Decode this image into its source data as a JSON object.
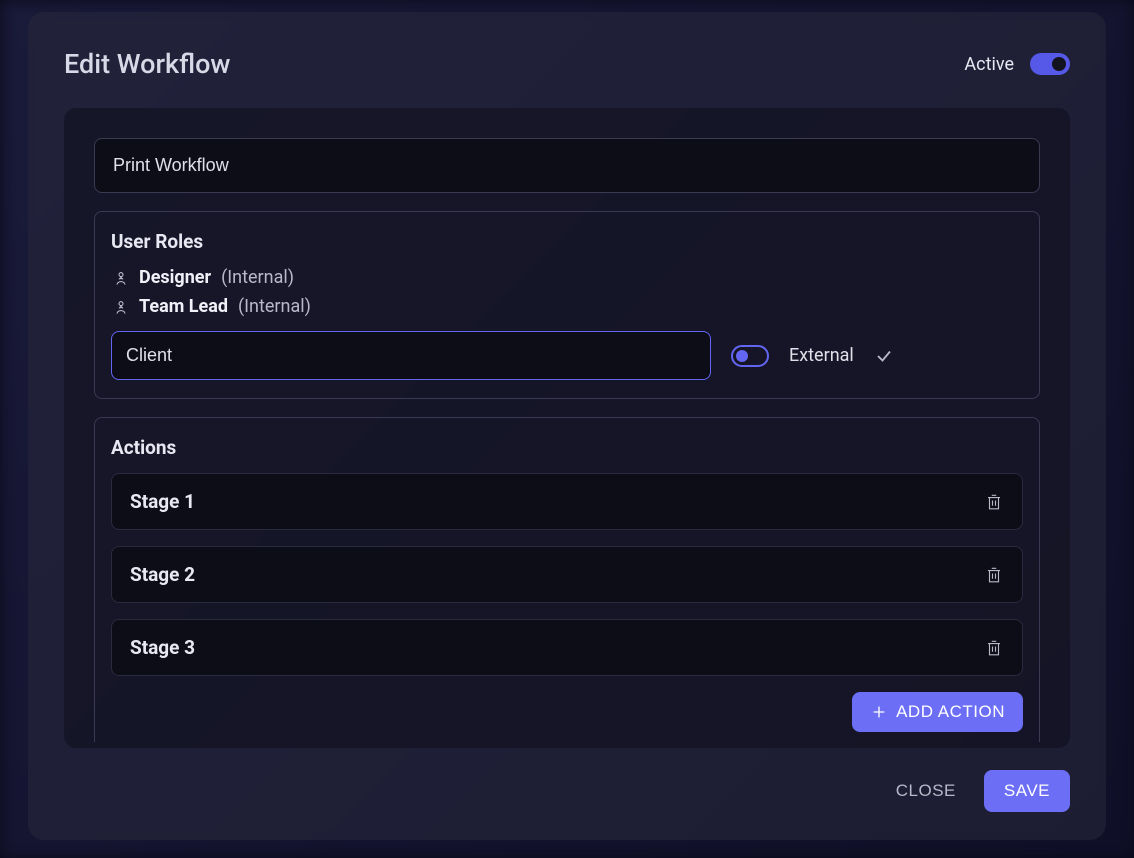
{
  "modal": {
    "title": "Edit Workflow",
    "active_label": "Active"
  },
  "workflow": {
    "name": "Print Workflow"
  },
  "userRoles": {
    "title": "User Roles",
    "roles": [
      {
        "name": "Designer",
        "scope": "(Internal)"
      },
      {
        "name": "Team Lead",
        "scope": "(Internal)"
      }
    ],
    "newRoleInput": "Client",
    "externalLabel": "External"
  },
  "actions": {
    "title": "Actions",
    "stages": [
      {
        "name": "Stage 1"
      },
      {
        "name": "Stage 2"
      },
      {
        "name": "Stage 3"
      }
    ],
    "addButton": "ADD ACTION"
  },
  "footer": {
    "close": "CLOSE",
    "save": "SAVE"
  }
}
